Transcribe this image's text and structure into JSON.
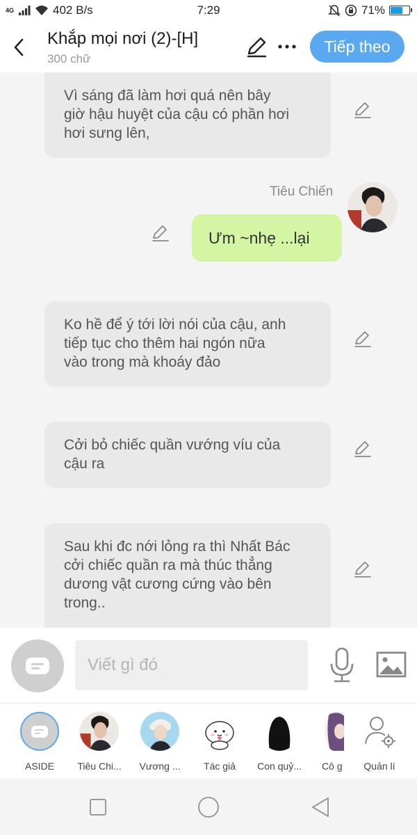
{
  "status_bar": {
    "network": "4G",
    "speed": "402 B/s",
    "time": "7:29",
    "battery": "71%",
    "battery_level": 0.71
  },
  "header": {
    "title": "Khắp mọi nơi (2)-[H]",
    "word_count": "300 chữ",
    "next_label": "Tiếp theo"
  },
  "messages": [
    {
      "text": "Vì sáng đã làm hơi quá nên bây\ngiờ hậu huyệt của cậu có phần hơi\nhơi sưng lên,"
    },
    {
      "speaker": "Tiêu Chiến",
      "text": "Ưm ~nhẹ ...lại"
    },
    {
      "text": "Ko hề để ý tới lời nói của cậu, anh\ntiếp tục cho thêm hai ngón nữa\nvào trong mà khoáy đảo"
    },
    {
      "text": "Cởi bỏ chiếc quần vướng víu của\ncậu ra"
    },
    {
      "text": "Sau khi đc nới lỏng ra thì Nhất Bác\ncởi chiếc quần ra mà thúc thẳng\ndương vật cương cứng vào bên\ntrong.."
    }
  ],
  "input": {
    "placeholder": "Viết gì đó"
  },
  "characters": [
    {
      "label": "ASIDE"
    },
    {
      "label": "Tiêu Chi..."
    },
    {
      "label": "Vương ..."
    },
    {
      "label": "Tác giả"
    },
    {
      "label": "Con quỷ..."
    },
    {
      "label": "Cô g"
    },
    {
      "label": "Quản lí"
    }
  ],
  "colors": {
    "accent": "#5aa9f0",
    "bubble_left": "#e9e9e9",
    "bubble_right": "#d4f5a3",
    "background": "#f4f4f4"
  }
}
